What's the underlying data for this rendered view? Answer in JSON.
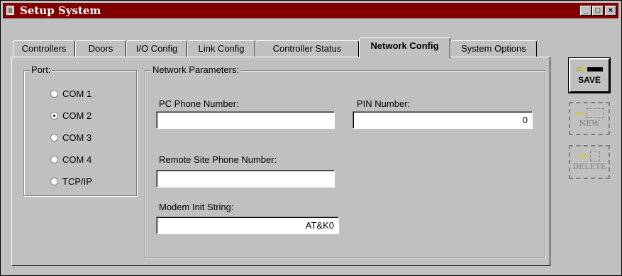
{
  "window": {
    "title": "Setup System",
    "min_label": "_",
    "max_label": "□",
    "close_label": "×"
  },
  "tabs": [
    {
      "label": "Controllers"
    },
    {
      "label": "Doors"
    },
    {
      "label": "I/O Config"
    },
    {
      "label": "Link Config"
    },
    {
      "label": "Controller Status"
    },
    {
      "label": "Network Config",
      "active": true
    },
    {
      "label": "System Options"
    }
  ],
  "port": {
    "title": "Port:",
    "options": [
      {
        "label": "COM 1",
        "selected": false
      },
      {
        "label": "COM 2",
        "selected": true
      },
      {
        "label": "COM 3",
        "selected": false
      },
      {
        "label": "COM 4",
        "selected": false
      },
      {
        "label": "TCP/IP",
        "selected": false
      }
    ]
  },
  "network": {
    "title": "Network Parameters:",
    "pc_phone_label": "PC Phone Number:",
    "pc_phone_value": "",
    "pin_label": "PIN Number:",
    "pin_value": "0",
    "remote_phone_label": "Remote Site Phone Number:",
    "remote_phone_value": "",
    "modem_init_label": "Modem Init String:",
    "modem_init_value": "AT&K0"
  },
  "actions": {
    "save_label": "SAVE",
    "new_label": "NEW",
    "delete_label": "DELETE"
  }
}
